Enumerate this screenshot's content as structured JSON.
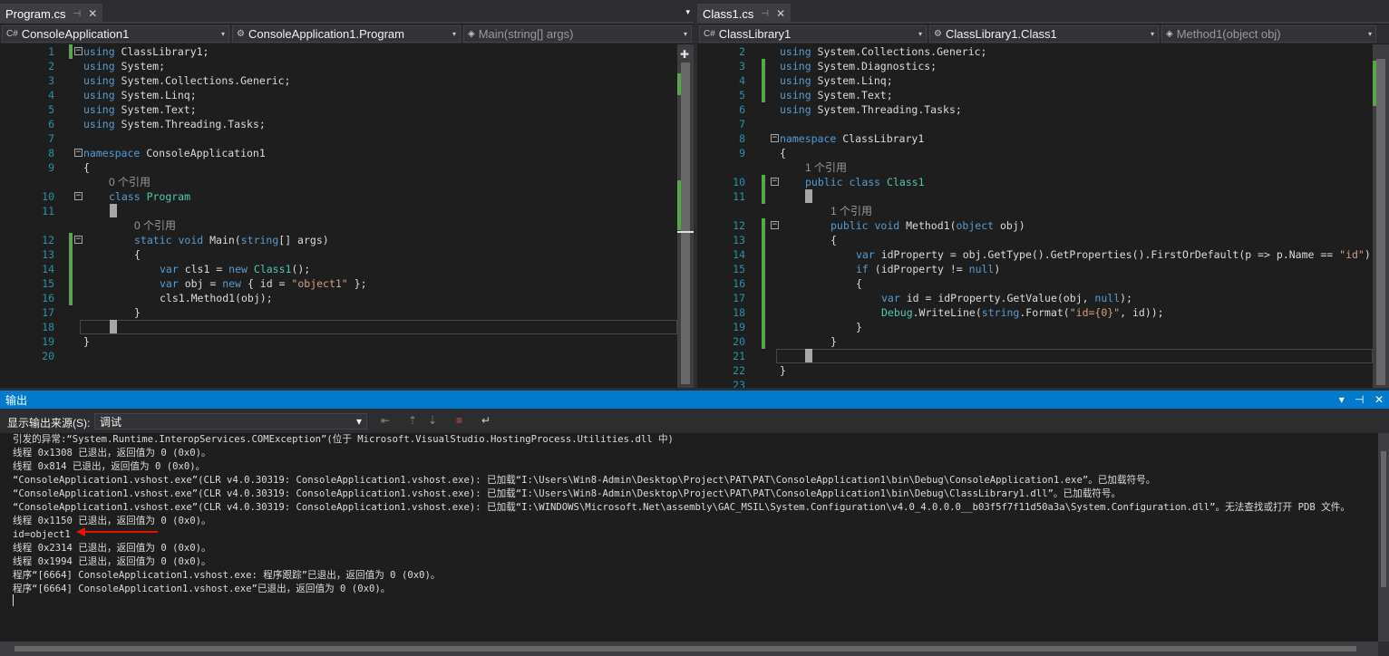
{
  "left": {
    "tab": {
      "name": "Program.cs",
      "pin": "⊣",
      "close": "✕"
    },
    "nav": {
      "project": "ConsoleApplication1",
      "type": "ConsoleApplication1.Program",
      "member": "Main(string[] args)"
    },
    "line_numbers": [
      "1",
      "2",
      "3",
      "4",
      "5",
      "6",
      "7",
      "8",
      "9",
      "",
      "10",
      "11",
      "",
      "12",
      "13",
      "14",
      "15",
      "16",
      "17",
      "18",
      "19",
      "20"
    ],
    "code": [
      [
        {
          "t": "using",
          "c": "kw"
        },
        {
          "t": " ClassLibrary1;"
        }
      ],
      [
        {
          "t": "using",
          "c": "kw"
        },
        {
          "t": " System;"
        }
      ],
      [
        {
          "t": "using",
          "c": "kw"
        },
        {
          "t": " System.Collections.Generic;"
        }
      ],
      [
        {
          "t": "using",
          "c": "kw"
        },
        {
          "t": " System.Linq;"
        }
      ],
      [
        {
          "t": "using",
          "c": "kw"
        },
        {
          "t": " System.Text;"
        }
      ],
      [
        {
          "t": "using",
          "c": "kw"
        },
        {
          "t": " System.Threading.Tasks;"
        }
      ],
      [],
      [
        {
          "t": "namespace",
          "c": "kw"
        },
        {
          "t": " ConsoleApplication1"
        }
      ],
      [
        {
          "t": "{"
        }
      ],
      [
        {
          "t": "0 个引用",
          "c": "lens"
        }
      ],
      [
        {
          "t": "class",
          "c": "kw"
        },
        {
          "t": " "
        },
        {
          "t": "Program",
          "c": "ty"
        }
      ],
      [],
      [
        {
          "t": "0 个引用",
          "c": "lens"
        }
      ],
      [
        {
          "t": "static",
          "c": "kw"
        },
        {
          "t": " "
        },
        {
          "t": "void",
          "c": "kw"
        },
        {
          "t": " Main("
        },
        {
          "t": "string",
          "c": "kw"
        },
        {
          "t": "[] args)"
        }
      ],
      [
        {
          "t": "{"
        }
      ],
      [
        {
          "t": "var",
          "c": "kw"
        },
        {
          "t": " cls1 = "
        },
        {
          "t": "new",
          "c": "kw"
        },
        {
          "t": " "
        },
        {
          "t": "Class1",
          "c": "ty"
        },
        {
          "t": "();"
        }
      ],
      [
        {
          "t": "var",
          "c": "kw"
        },
        {
          "t": " obj = "
        },
        {
          "t": "new",
          "c": "kw"
        },
        {
          "t": " { id = "
        },
        {
          "t": "\"object1\"",
          "c": "str"
        },
        {
          "t": " };"
        }
      ],
      [
        {
          "t": "cls1.Method1(obj);"
        }
      ],
      [
        {
          "t": "}"
        }
      ],
      [],
      [
        {
          "t": "}"
        }
      ],
      []
    ]
  },
  "right": {
    "tab": {
      "name": "Class1.cs",
      "pin": "⊣",
      "close": "✕"
    },
    "nav": {
      "project": "ClassLibrary1",
      "type": "ClassLibrary1.Class1",
      "member": "Method1(object obj)"
    },
    "line_numbers": [
      "2",
      "3",
      "4",
      "5",
      "6",
      "7",
      "8",
      "9",
      "",
      "10",
      "11",
      "",
      "12",
      "13",
      "14",
      "15",
      "16",
      "17",
      "18",
      "19",
      "20",
      "21",
      "22",
      "23"
    ],
    "code": [
      [
        {
          "t": "using",
          "c": "kw"
        },
        {
          "t": " System.Collections.Generic;"
        }
      ],
      [
        {
          "t": "using",
          "c": "kw"
        },
        {
          "t": " System.Diagnostics;"
        }
      ],
      [
        {
          "t": "using",
          "c": "kw"
        },
        {
          "t": " System.Linq;"
        }
      ],
      [
        {
          "t": "using",
          "c": "kw"
        },
        {
          "t": " System.Text;"
        }
      ],
      [
        {
          "t": "using",
          "c": "kw"
        },
        {
          "t": " System.Threading.Tasks;"
        }
      ],
      [],
      [
        {
          "t": "namespace",
          "c": "kw"
        },
        {
          "t": " ClassLibrary1"
        }
      ],
      [
        {
          "t": "{"
        }
      ],
      [
        {
          "t": "1 个引用",
          "c": "lens"
        }
      ],
      [
        {
          "t": "public",
          "c": "kw"
        },
        {
          "t": " "
        },
        {
          "t": "class",
          "c": "kw"
        },
        {
          "t": " "
        },
        {
          "t": "Class1",
          "c": "ty"
        }
      ],
      [],
      [
        {
          "t": "1 个引用",
          "c": "lens"
        }
      ],
      [
        {
          "t": "public",
          "c": "kw"
        },
        {
          "t": " "
        },
        {
          "t": "void",
          "c": "kw"
        },
        {
          "t": " Method1("
        },
        {
          "t": "object",
          "c": "kw"
        },
        {
          "t": " obj)"
        }
      ],
      [
        {
          "t": "{"
        }
      ],
      [
        {
          "t": "var",
          "c": "kw"
        },
        {
          "t": " idProperty = obj.GetType().GetProperties().FirstOrDefault(p => p.Name == "
        },
        {
          "t": "\"id\"",
          "c": "str"
        },
        {
          "t": ");"
        }
      ],
      [
        {
          "t": "if",
          "c": "kw"
        },
        {
          "t": " (idProperty != "
        },
        {
          "t": "null",
          "c": "kw"
        },
        {
          "t": ")"
        }
      ],
      [
        {
          "t": "{"
        }
      ],
      [
        {
          "t": "var",
          "c": "kw"
        },
        {
          "t": " id = idProperty.GetValue(obj, "
        },
        {
          "t": "null",
          "c": "kw"
        },
        {
          "t": ");"
        }
      ],
      [
        {
          "t": "Debug",
          "c": "ty"
        },
        {
          "t": ".WriteLine("
        },
        {
          "t": "string",
          "c": "kw"
        },
        {
          "t": ".Format("
        },
        {
          "t": "\"id={0}\"",
          "c": "str"
        },
        {
          "t": ", id));"
        }
      ],
      [
        {
          "t": "}"
        }
      ],
      [
        {
          "t": "}"
        }
      ],
      [],
      [
        {
          "t": "}"
        }
      ],
      []
    ]
  },
  "output": {
    "title": "输出",
    "header_tools": [
      "▾",
      "⊣",
      "✕"
    ],
    "source_label": "显示输出来源(S):",
    "source_value": "调试",
    "combo_arrow": "▾",
    "lines": [
      "引发的异常:“System.Runtime.InteropServices.COMException”(位于 Microsoft.VisualStudio.HostingProcess.Utilities.dll 中)",
      "线程 0x1308 已退出，返回值为 0 (0x0)。",
      "线程 0x814 已退出，返回值为 0 (0x0)。",
      "“ConsoleApplication1.vshost.exe”(CLR v4.0.30319: ConsoleApplication1.vshost.exe): 已加载“I:\\Users\\Win8-Admin\\Desktop\\Project\\PAT\\PAT\\ConsoleApplication1\\bin\\Debug\\ConsoleApplication1.exe”。已加载符号。",
      "“ConsoleApplication1.vshost.exe”(CLR v4.0.30319: ConsoleApplication1.vshost.exe): 已加载“I:\\Users\\Win8-Admin\\Desktop\\Project\\PAT\\PAT\\ConsoleApplication1\\bin\\Debug\\ClassLibrary1.dll”。已加载符号。",
      "“ConsoleApplication1.vshost.exe”(CLR v4.0.30319: ConsoleApplication1.vshost.exe): 已加载“I:\\WINDOWS\\Microsoft.Net\\assembly\\GAC_MSIL\\System.Configuration\\v4.0_4.0.0.0__b03f5f7f11d50a3a\\System.Configuration.dll”。无法查找或打开 PDB 文件。",
      "线程 0x1150 已退出，返回值为 0 (0x0)。",
      "id=object1",
      "线程 0x2314 已退出，返回值为 0 (0x0)。",
      "线程 0x1994 已退出，返回值为 0 (0x0)。",
      "程序“[6664] ConsoleApplication1.vshost.exe: 程序跟踪”已退出，返回值为 0 (0x0)。",
      "程序“[6664] ConsoleApplication1.vshost.exe”已退出，返回值为 0 (0x0)。"
    ]
  },
  "icons": {
    "cs_project": "C#",
    "class_type": "⚙",
    "method_member": "◈",
    "dropdown": "▾",
    "split": "✚",
    "tab_overflow": "▾"
  },
  "colors": {
    "keyword": "#569cd6",
    "type": "#4ec9b0",
    "string": "#d69d85",
    "line_number": "#2b91af",
    "change_bar": "#57a64a",
    "output_header": "#007acc",
    "annotation_arrow": "#e51400"
  }
}
